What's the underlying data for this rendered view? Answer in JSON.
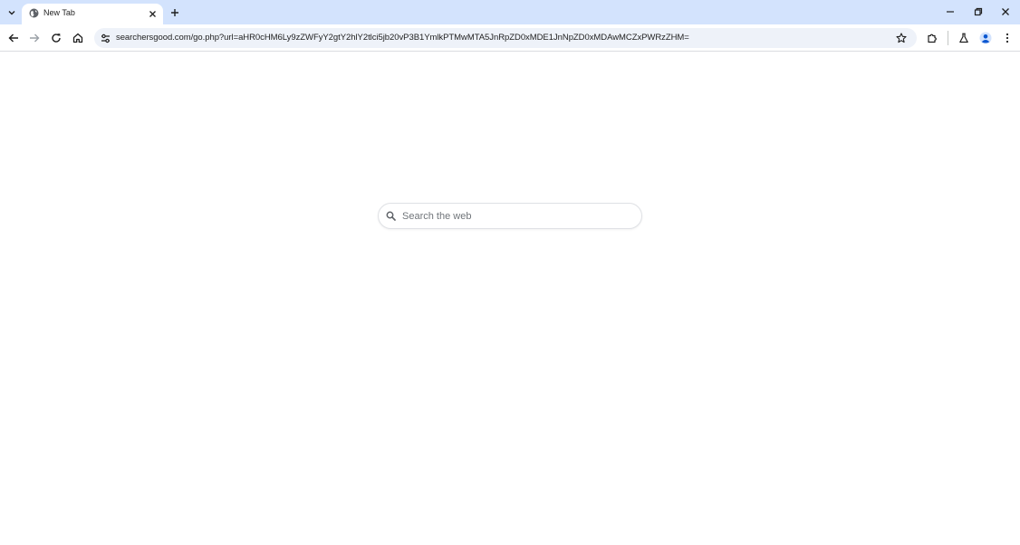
{
  "browser": {
    "tab": {
      "title": "New Tab",
      "favicon": "globe-icon"
    },
    "address_bar": {
      "url": "searchersgood.com/go.php?url=aHR0cHM6Ly9zZWFyY2gtY2hlY2tlci5jb20vP3B1YmlkPTMwMTA5JnRpZD0xMDE1JnNpZD0xMDAwMCZxPWRzZHM="
    },
    "icons": {
      "tab_search": "chevron-down-icon",
      "close_tab": "close-icon",
      "new_tab": "plus-icon",
      "back": "arrow-left-icon",
      "forward": "arrow-right-icon",
      "reload": "reload-icon",
      "home": "home-icon",
      "site_info": "tune-icon",
      "bookmark": "star-icon",
      "extensions": "puzzle-icon",
      "labs": "flask-icon",
      "profile": "person-icon",
      "menu": "kebab-menu-icon",
      "minimize": "minimize-icon",
      "restore": "restore-icon",
      "close_window": "close-icon"
    },
    "colors": {
      "tabstrip": "#d3e3fd",
      "omnibox": "#eef2f9",
      "accent": "#0b57d0"
    }
  },
  "page": {
    "search": {
      "placeholder": "Search the web",
      "value": "",
      "icon": "search-icon"
    }
  }
}
